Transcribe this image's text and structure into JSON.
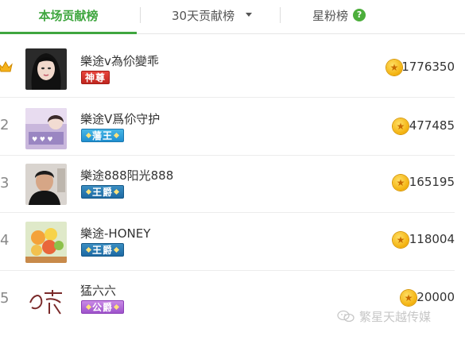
{
  "tabs": {
    "current": "本场贡献榜",
    "thirty_day": "30天贡献榜",
    "fans": "星粉榜",
    "help_glyph": "?"
  },
  "accent_color": "#3fa63f",
  "rows": [
    {
      "rank": "",
      "rank_icon": "crown-icon",
      "name": "樂途v為伱變乖",
      "badge": "神尊",
      "badge_color": "#d63a32",
      "score": "1776350"
    },
    {
      "rank": "2",
      "name": "樂途V爲伱守护",
      "badge": "藩王",
      "badge_color": "#2f9fdc",
      "score": "477485"
    },
    {
      "rank": "3",
      "name": "樂途888阳光888",
      "badge": "王爵",
      "badge_color": "#2a7db8",
      "score": "165195"
    },
    {
      "rank": "4",
      "name": "樂途-HONEY",
      "badge": "王爵",
      "badge_color": "#2a7db8",
      "score": "118004"
    },
    {
      "rank": "5",
      "name": "猛六六",
      "badge": "公爵",
      "badge_color": "#b46ad9",
      "score": "20000"
    }
  ],
  "watermark": "繁星天越传媒"
}
